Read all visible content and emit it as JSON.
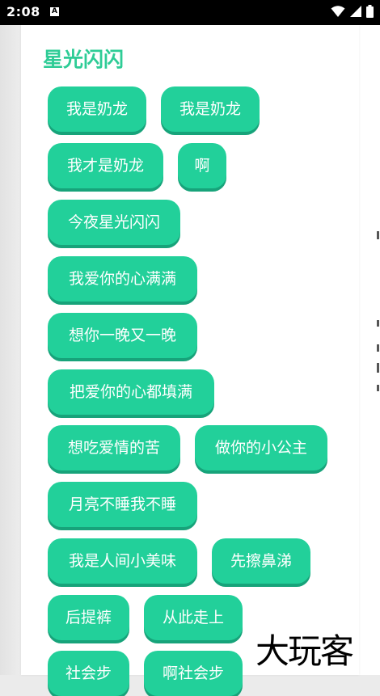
{
  "status_bar": {
    "time": "2:08",
    "notification_glyph": "A",
    "icons": [
      "wifi-icon",
      "signal-icon",
      "battery-icon"
    ]
  },
  "page": {
    "title": "星光闪闪"
  },
  "tags": [
    "我是奶龙",
    "我是奶龙",
    "我才是奶龙",
    "啊",
    "今夜星光闪闪",
    "我爱你的心满满",
    "想你一晚又一晚",
    "把爱你的心都填满",
    "想吃爱情的苦",
    "做你的小公主",
    "月亮不睡我不睡",
    "我是人间小美味",
    "先擦鼻涕",
    "后提裤",
    "从此走上",
    "社会步",
    "啊社会步"
  ],
  "watermark": "大玩客",
  "colors": {
    "tag_fill": "#22d09a",
    "tag_shadow": "#17a37a",
    "title": "#2ecc96",
    "status_bar": "#000000"
  }
}
